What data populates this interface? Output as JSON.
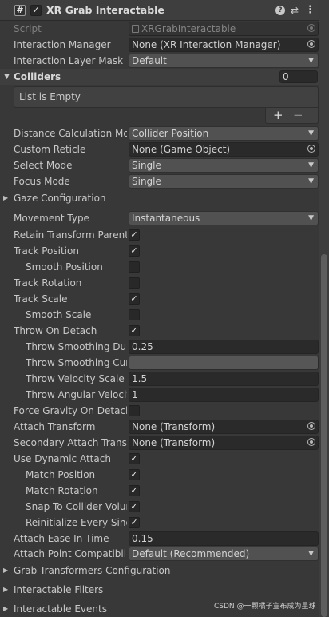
{
  "header": {
    "script_icon": "hash-script-icon",
    "enabled": true,
    "title": "XR Grab Interactable",
    "help_icon": "?",
    "settings_icon": "⇄",
    "menu_icon": "⋮"
  },
  "fields": {
    "script": {
      "label": "Script",
      "value": "XRGrabInteractable"
    },
    "interaction_manager": {
      "label": "Interaction Manager",
      "value": "None (XR Interaction Manager)"
    },
    "interaction_layer_mask": {
      "label": "Interaction Layer Mask",
      "value": "Default"
    },
    "colliders": {
      "label": "Colliders",
      "count": "0",
      "empty_text": "List is Empty",
      "add": "+",
      "remove": "−"
    },
    "distance_calc": {
      "label": "Distance Calculation Mode",
      "value": "Collider Position"
    },
    "custom_reticle": {
      "label": "Custom Reticle",
      "value": "None (Game Object)"
    },
    "select_mode": {
      "label": "Select Mode",
      "value": "Single"
    },
    "focus_mode": {
      "label": "Focus Mode",
      "value": "Single"
    },
    "gaze_config": {
      "label": "Gaze Configuration"
    },
    "movement_type": {
      "label": "Movement Type",
      "value": "Instantaneous"
    },
    "retain_transform_parent": {
      "label": "Retain Transform Parent",
      "checked": true
    },
    "track_position": {
      "label": "Track Position",
      "checked": true
    },
    "smooth_position": {
      "label": "Smooth Position",
      "checked": false
    },
    "track_rotation": {
      "label": "Track Rotation",
      "checked": false
    },
    "track_scale": {
      "label": "Track Scale",
      "checked": true
    },
    "smooth_scale": {
      "label": "Smooth Scale",
      "checked": false
    },
    "throw_on_detach": {
      "label": "Throw On Detach",
      "checked": true
    },
    "throw_smoothing_duration": {
      "label": "Throw Smoothing Duration",
      "value": "0.25"
    },
    "throw_smoothing_curve": {
      "label": "Throw Smoothing Curve"
    },
    "throw_velocity_scale": {
      "label": "Throw Velocity Scale",
      "value": "1.5"
    },
    "throw_angular_velocity_scale": {
      "label": "Throw Angular Velocity Scale",
      "value": "1"
    },
    "force_gravity_on_detach": {
      "label": "Force Gravity On Detach",
      "checked": false
    },
    "attach_transform": {
      "label": "Attach Transform",
      "value": "None (Transform)"
    },
    "secondary_attach_transform": {
      "label": "Secondary Attach Transform",
      "value": "None (Transform)"
    },
    "use_dynamic_attach": {
      "label": "Use Dynamic Attach",
      "checked": true
    },
    "match_position": {
      "label": "Match Position",
      "checked": true
    },
    "match_rotation": {
      "label": "Match Rotation",
      "checked": true
    },
    "snap_to_collider_volume": {
      "label": "Snap To Collider Volume",
      "checked": true
    },
    "reinitialize_every_single_grab": {
      "label": "Reinitialize Every Single Grab",
      "checked": true
    },
    "attach_ease_in_time": {
      "label": "Attach Ease In Time",
      "value": "0.15"
    },
    "attach_point_compat": {
      "label": "Attach Point Compatibility Mode",
      "value": "Default (Recommended)"
    },
    "grab_transformers_config": {
      "label": "Grab Transformers Configuration"
    },
    "interactable_filters": {
      "label": "Interactable Filters"
    },
    "interactable_events": {
      "label": "Interactable Events"
    }
  },
  "watermark": "CSDN @一颗橘子宣布成为星球",
  "check_glyph": "✓",
  "colors": {
    "background": "#383838",
    "header": "#3e3e3e",
    "field": "#2a2a2a",
    "dropdown": "#515151"
  }
}
